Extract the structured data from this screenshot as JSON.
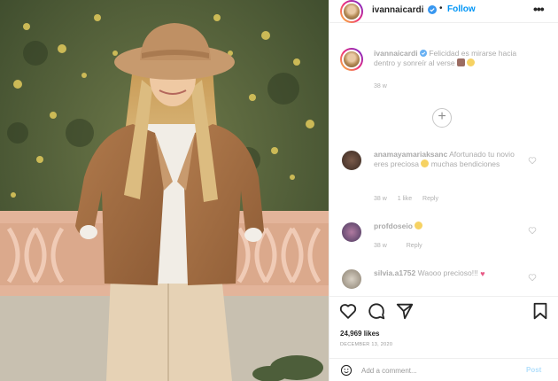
{
  "header": {
    "username": "ivannaicardi",
    "separator": "•",
    "follow_label": "Follow",
    "more_label": "•••",
    "verified": true
  },
  "caption": {
    "username": "ivannaicardi",
    "text": "Felicidad es mirarse hacia dentro y sonreír al verse",
    "time": "38 w"
  },
  "load_more_label": "+",
  "comments": [
    {
      "username": "anamayamariaksanc",
      "text": "Afortunado tu novio eres preciosa",
      "text2": "muchas bendiciones",
      "time": "38 w",
      "likes": "1 like",
      "reply": "Reply"
    },
    {
      "username": "profdoseio",
      "text": "",
      "time": "38 w",
      "likes": "",
      "reply": "Reply"
    },
    {
      "username": "silvia.a1752",
      "text": "Waooo precioso!!!",
      "time": "",
      "likes": "",
      "reply": ""
    }
  ],
  "actions": {
    "likes_count": "24,969 likes",
    "date": "DECEMBER 13, 2020"
  },
  "add_comment": {
    "placeholder": "Add a comment...",
    "post_label": "Post"
  },
  "colors": {
    "accent": "#0095f6",
    "heart": "#e0245e"
  }
}
